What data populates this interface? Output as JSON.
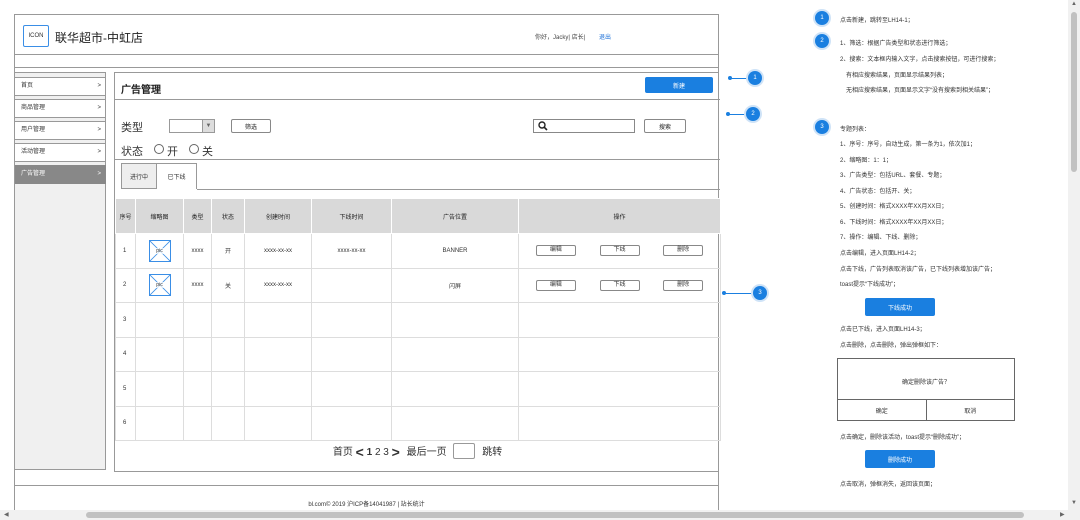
{
  "header": {
    "logo": "ICON",
    "store_name": "联华超市-中虹店",
    "greeting": "你好，Jacky|  店长|",
    "logout": "退出"
  },
  "sidebar": {
    "items": [
      {
        "label": "首页",
        "arrow": ">"
      },
      {
        "label": "商品管理",
        "arrow": ">"
      },
      {
        "label": "用户管理",
        "arrow": ">"
      },
      {
        "label": "活动管理",
        "arrow": ">"
      },
      {
        "label": "广告管理",
        "arrow": ">",
        "active": true
      }
    ]
  },
  "main": {
    "title": "广告管理",
    "new_button": "新建",
    "filter": {
      "type_label": "类型",
      "filter_button": "筛选",
      "search_button": "搜索",
      "status_label": "状态",
      "status_on": "开",
      "status_off": "关"
    },
    "tabs": [
      "进行中",
      "已下线"
    ],
    "table": {
      "headers": [
        "序号",
        "缩略图",
        "类型",
        "状态",
        "创建时间",
        "下线时间",
        "广告位置",
        "操作"
      ],
      "rows": [
        {
          "no": "1",
          "pic": "pic",
          "type": "xxxx",
          "status": "开",
          "created": "xxxx-xx-xx",
          "offline": "xxxx-xx-xx",
          "position": "BANNER",
          "ops": [
            "编辑",
            "下线",
            "删除"
          ]
        },
        {
          "no": "2",
          "pic": "pic",
          "type": "xxxx",
          "status": "关",
          "created": "xxxx-xx-xx",
          "offline": "",
          "position": "闪屏",
          "ops": [
            "编辑",
            "下线",
            "删除"
          ]
        },
        {
          "no": "3"
        },
        {
          "no": "4"
        },
        {
          "no": "5"
        },
        {
          "no": "6"
        }
      ]
    },
    "pager": {
      "first": "首页",
      "prev": "<",
      "page_current": "1",
      "page_2": "2",
      "page_3": "3",
      "next": ">",
      "last": "最后一页",
      "jump": "跳转"
    }
  },
  "footer": "bl.com© 2019  沪ICP备14041987  |  站长统计",
  "callouts": [
    "1",
    "2",
    "3"
  ],
  "notes": {
    "n1": "点击新建，跳转至LH14-1；",
    "n2a": "1、筛选：根据广告类型和状态进行筛选；",
    "n2b": "2、搜索：文本框内输入文字，点击搜索按钮，可进行搜索；",
    "n2c": "有相应搜索结果，页面显示结果列表；",
    "n2d": "无相应搜索结果，页面显示文字“没有搜索到相关结果”；",
    "n3_title": "专题列表：",
    "n3_1": "1、序号：序号，自动生成，第一条为1，依次加1；",
    "n3_2": "2、缩略图：1：1；",
    "n3_3": "3、广告类型：包括URL、套餐、专题；",
    "n3_4": "4、广告状态：包括开、关；",
    "n3_5": "5、创建时间：格式XXXX年XX月XX日；",
    "n3_6": "6、下线时间：格式XXXX年XX月XX日；",
    "n3_7": "7、操作：编辑、下线、删除；",
    "n3_edit": "点击编辑，进入页面LH14-2；",
    "n3_offline": "点击下线，广告列表取消该广告，已下线列表增加该广告；",
    "n3_toast1": "toast提示“下线成功”；",
    "offline_success": "下线成功",
    "n3_offlined": "点击已下线，进入页面LH14-3；",
    "n3_delete": "点击删除，点击删除，弹出弹框如下：",
    "dialog_msg": "确定删除该广告？",
    "dialog_ok": "确定",
    "dialog_cancel": "取消",
    "n3_confirm": "点击确定，删除该活动，toast提示“删除成功”；",
    "delete_success": "删除成功",
    "n3_cancel": "点击取消，弹框消失，返回该页面；"
  },
  "colors": {
    "accent": "#1a7fe0",
    "border": "#999999",
    "table_header": "#d9d9d9",
    "active_nav": "#888888"
  }
}
